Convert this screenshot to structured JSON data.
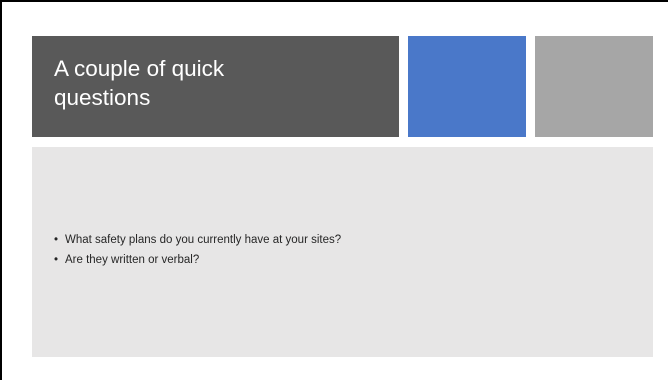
{
  "slide": {
    "title": "A couple of quick questions",
    "bullets": [
      "What safety plans do you currently have at your sites?",
      "Are they written or verbal?"
    ],
    "bullet_glyph": "•"
  },
  "colors": {
    "title_bg": "#595959",
    "accent_blue": "#4a78c9",
    "accent_gray": "#a6a6a6",
    "content_bg": "#e7e6e6"
  }
}
